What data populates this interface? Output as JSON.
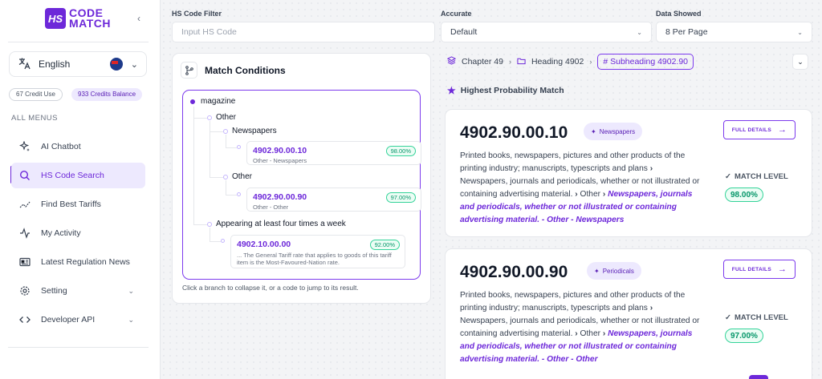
{
  "brand": {
    "badge": "HS",
    "line1": "CODE",
    "line2": "MATCH",
    "accent": "#6d28d9"
  },
  "language": {
    "label": "English"
  },
  "credits": {
    "used": "67 Credit Use",
    "balance": "933 Credits Balance"
  },
  "menu": {
    "heading": "ALL MENUS",
    "items": [
      {
        "label": "AI Chatbot",
        "icon": "sparkles-icon"
      },
      {
        "label": "HS Code Search",
        "icon": "search-icon",
        "active": true
      },
      {
        "label": "Find Best Tariffs",
        "icon": "trend-icon"
      },
      {
        "label": "My Activity",
        "icon": "activity-icon"
      },
      {
        "label": "Latest Regulation News",
        "icon": "news-icon"
      },
      {
        "label": "Setting",
        "icon": "gear-icon"
      },
      {
        "label": "Developer API",
        "icon": "code-icon"
      }
    ]
  },
  "filters": {
    "hs_label": "HS Code Filter",
    "hs_placeholder": "Input HS Code",
    "accurate_label": "Accurate",
    "accurate_value": "Default",
    "data_label": "Data Showed",
    "data_value": "8 Per Page"
  },
  "conditions": {
    "title": "Match Conditions",
    "root": "magazine",
    "other1": "Other",
    "newspapers": "Newspapers",
    "leaf1": {
      "code": "4902.90.00.10",
      "desc": "Other - Newspapers",
      "pct": "98.00%"
    },
    "other2": "Other",
    "leaf2": {
      "code": "4902.90.00.90",
      "desc": "Other - Other",
      "pct": "97.00%"
    },
    "appearing": "Appearing at least four times a week",
    "leaf3": {
      "code": "4902.10.00.00",
      "desc1": "... The General Tariff rate that applies to goods of this tariff",
      "desc2": "item is the Most-Favoured-Nation rate.",
      "pct": "92.00%"
    },
    "footer": "Click a branch to collapse it, or a code to jump to its result."
  },
  "breadcrumb": {
    "chapter": "Chapter 49",
    "heading": "Heading 4902",
    "subheading": "# Subheading 4902.90"
  },
  "results": {
    "heading": "Highest Probability Match",
    "full_label": "FULL DETAILS",
    "match_label": "MATCH LEVEL",
    "cards": [
      {
        "code": "4902.90.00.10",
        "tag": "Newspapers",
        "t1": "Printed books, newspapers, pictures and other products of the",
        "t2": "printing industry; manuscripts, typescripts and plans",
        "t3": "Newspapers, journals and periodicals, whether or not illustrated or",
        "t4": "containing advertising material.",
        "t4b": "Other",
        "t4c": "Newspapers, journals",
        "t5": "and periodicals, whether or not illustrated or containing",
        "t6": "advertising material. - Other - Newspapers",
        "pct": "98.00%"
      },
      {
        "code": "4902.90.00.90",
        "tag": "Periodicals",
        "t1": "Printed books, newspapers, pictures and other products of the",
        "t2": "printing industry; manuscripts, typescripts and plans",
        "t3": "Newspapers, journals and periodicals, whether or not illustrated or",
        "t4": "containing advertising material.",
        "t4b": "Other",
        "t4c": "Newspapers, journals",
        "t5": "and periodicals, whether or not illustrated or containing",
        "t6": "advertising material. - Other - Other",
        "pct": "97.00%"
      }
    ]
  }
}
